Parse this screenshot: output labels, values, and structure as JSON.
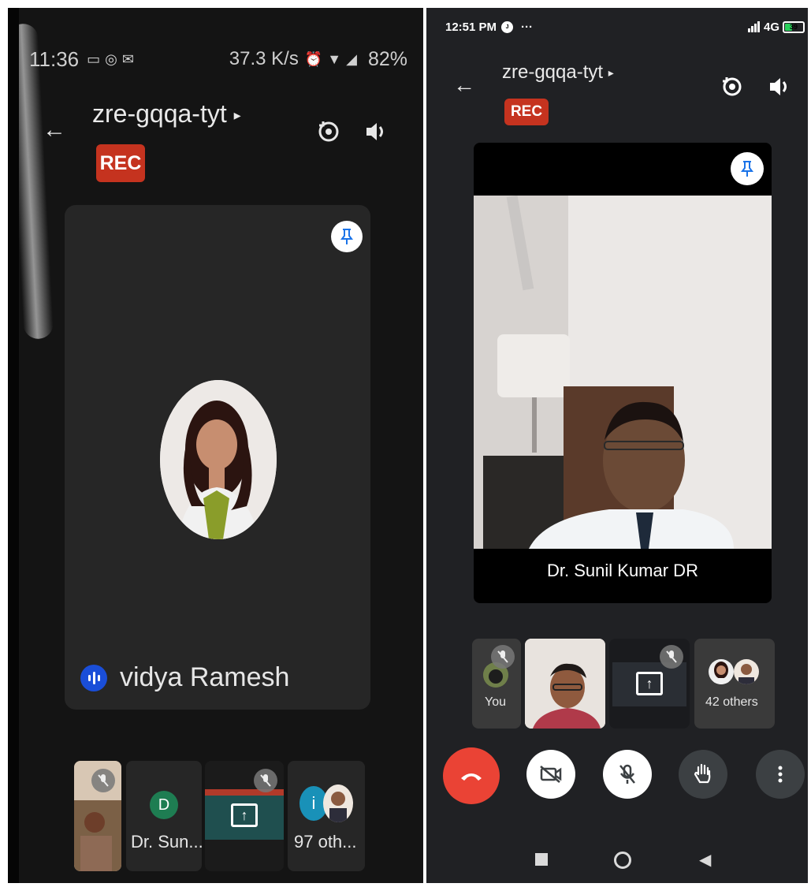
{
  "left_phone": {
    "status_bar": {
      "time": "11:36",
      "net_rate": "37.3 K/s",
      "battery": "82%"
    },
    "meeting_code": "zre-gqqa-tyt",
    "rec_badge": "REC",
    "main_tile": {
      "name": "vidya Ramesh"
    },
    "thumbnails": [
      {
        "kind": "video",
        "muted": true
      },
      {
        "kind": "avatar",
        "letter": "D",
        "label": "Dr. Sun...",
        "color": "#1e7d52"
      },
      {
        "kind": "screen",
        "muted": true
      },
      {
        "kind": "others",
        "letter": "i",
        "label": "97 oth...",
        "color": "#1991b8"
      }
    ]
  },
  "right_phone": {
    "status_bar": {
      "time": "12:51 PM",
      "dots": "···",
      "network": "4G",
      "battery": "39"
    },
    "meeting_code": "zre-gqqa-tyt",
    "rec_badge": "REC",
    "main_tile": {
      "name": "Dr. Sunil Kumar DR"
    },
    "thumbnails": [
      {
        "kind": "self",
        "label": "You",
        "muted": true
      },
      {
        "kind": "video"
      },
      {
        "kind": "screen",
        "muted": true
      },
      {
        "kind": "others",
        "label": "42 others"
      }
    ],
    "controls": {
      "end_call_color": "#ea4335",
      "button_bg": "#ffffff",
      "secondary_bg": "#3c4043"
    }
  }
}
